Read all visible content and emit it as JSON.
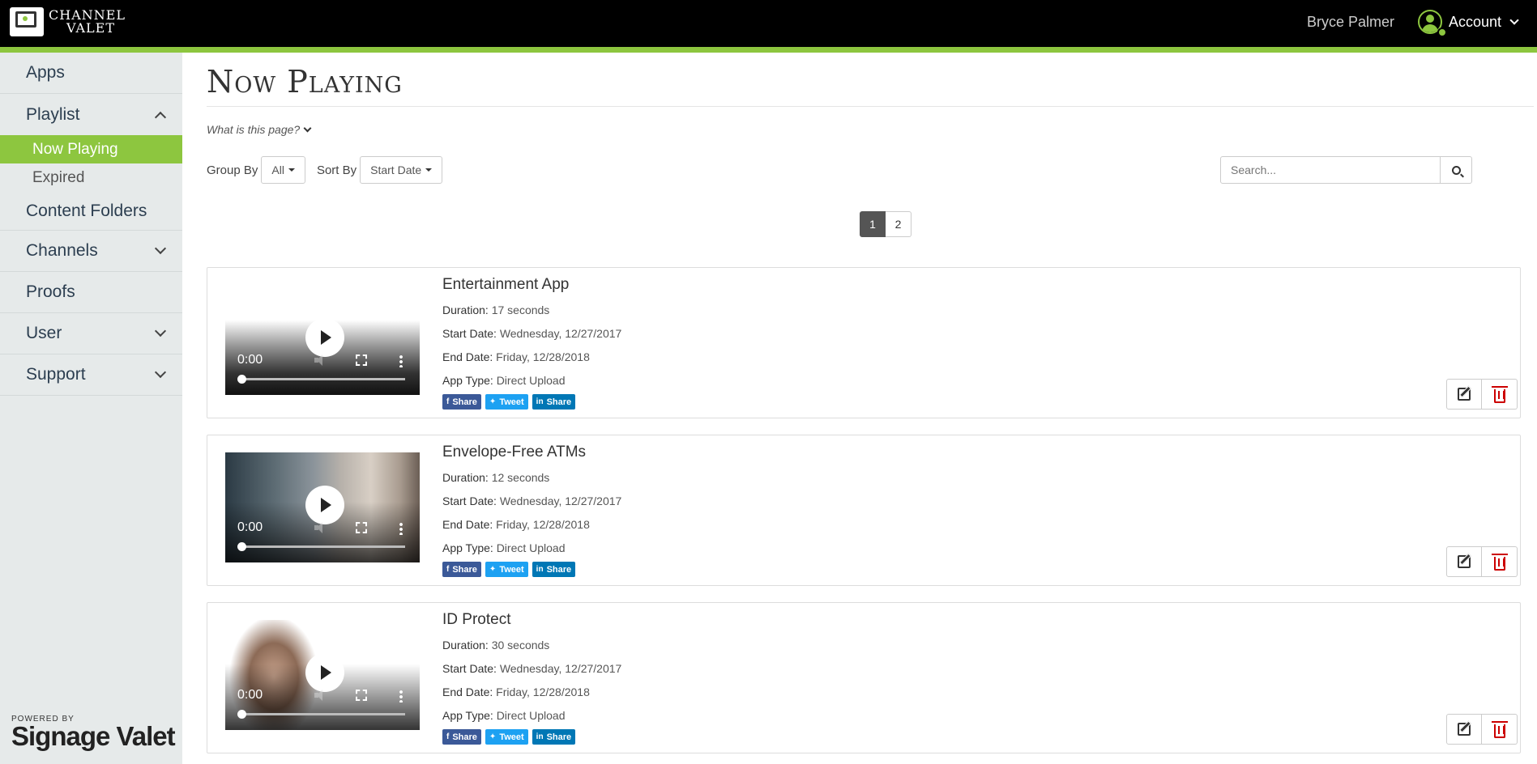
{
  "header": {
    "logo_line1": "CHANNEL",
    "logo_line2": "VALET",
    "user_name": "Bryce Palmer",
    "account_label": "Account"
  },
  "sidebar": {
    "items": [
      {
        "label": "Apps"
      },
      {
        "label": "Playlist",
        "expanded": true
      },
      {
        "label": "Content Folders"
      },
      {
        "label": "Channels",
        "expanded": false
      },
      {
        "label": "Proofs"
      },
      {
        "label": "User",
        "expanded": false
      },
      {
        "label": "Support",
        "expanded": false
      }
    ],
    "playlist_sub": [
      {
        "label": "Now Playing",
        "active": true
      },
      {
        "label": "Expired",
        "active": false
      }
    ],
    "powered_by": "POWERED BY",
    "brand": "Signage Valet"
  },
  "main": {
    "title": "Now Playing",
    "help_text": "What is this page?",
    "group_by_label": "Group By",
    "group_by_value": "All",
    "sort_by_label": "Sort By",
    "sort_by_value": "Start Date",
    "search_placeholder": "Search...",
    "pages": [
      "1",
      "2"
    ],
    "current_page": "1"
  },
  "labels": {
    "duration": "Duration:",
    "start_date": "Start Date:",
    "end_date": "End Date:",
    "app_type": "App Type:",
    "video_time": "0:00",
    "share_fb": "Share",
    "share_tw": "Tweet",
    "share_li": "Share"
  },
  "apps": [
    {
      "title": "Entertainment App",
      "duration": "17 seconds",
      "start_date": "Wednesday, 12/27/2017",
      "end_date": "Friday, 12/28/2018",
      "app_type": "Direct Upload"
    },
    {
      "title": "Envelope-Free ATMs",
      "duration": "12 seconds",
      "start_date": "Wednesday, 12/27/2017",
      "end_date": "Friday, 12/28/2018",
      "app_type": "Direct Upload"
    },
    {
      "title": "ID Protect",
      "duration": "30 seconds",
      "start_date": "Wednesday, 12/27/2017",
      "end_date": "Friday, 12/28/2018",
      "app_type": "Direct Upload"
    }
  ],
  "colors": {
    "accent": "#8dc63f",
    "facebook": "#3b5998",
    "twitter": "#1da1f2",
    "linkedin": "#0077b5",
    "delete": "#cc0000"
  }
}
